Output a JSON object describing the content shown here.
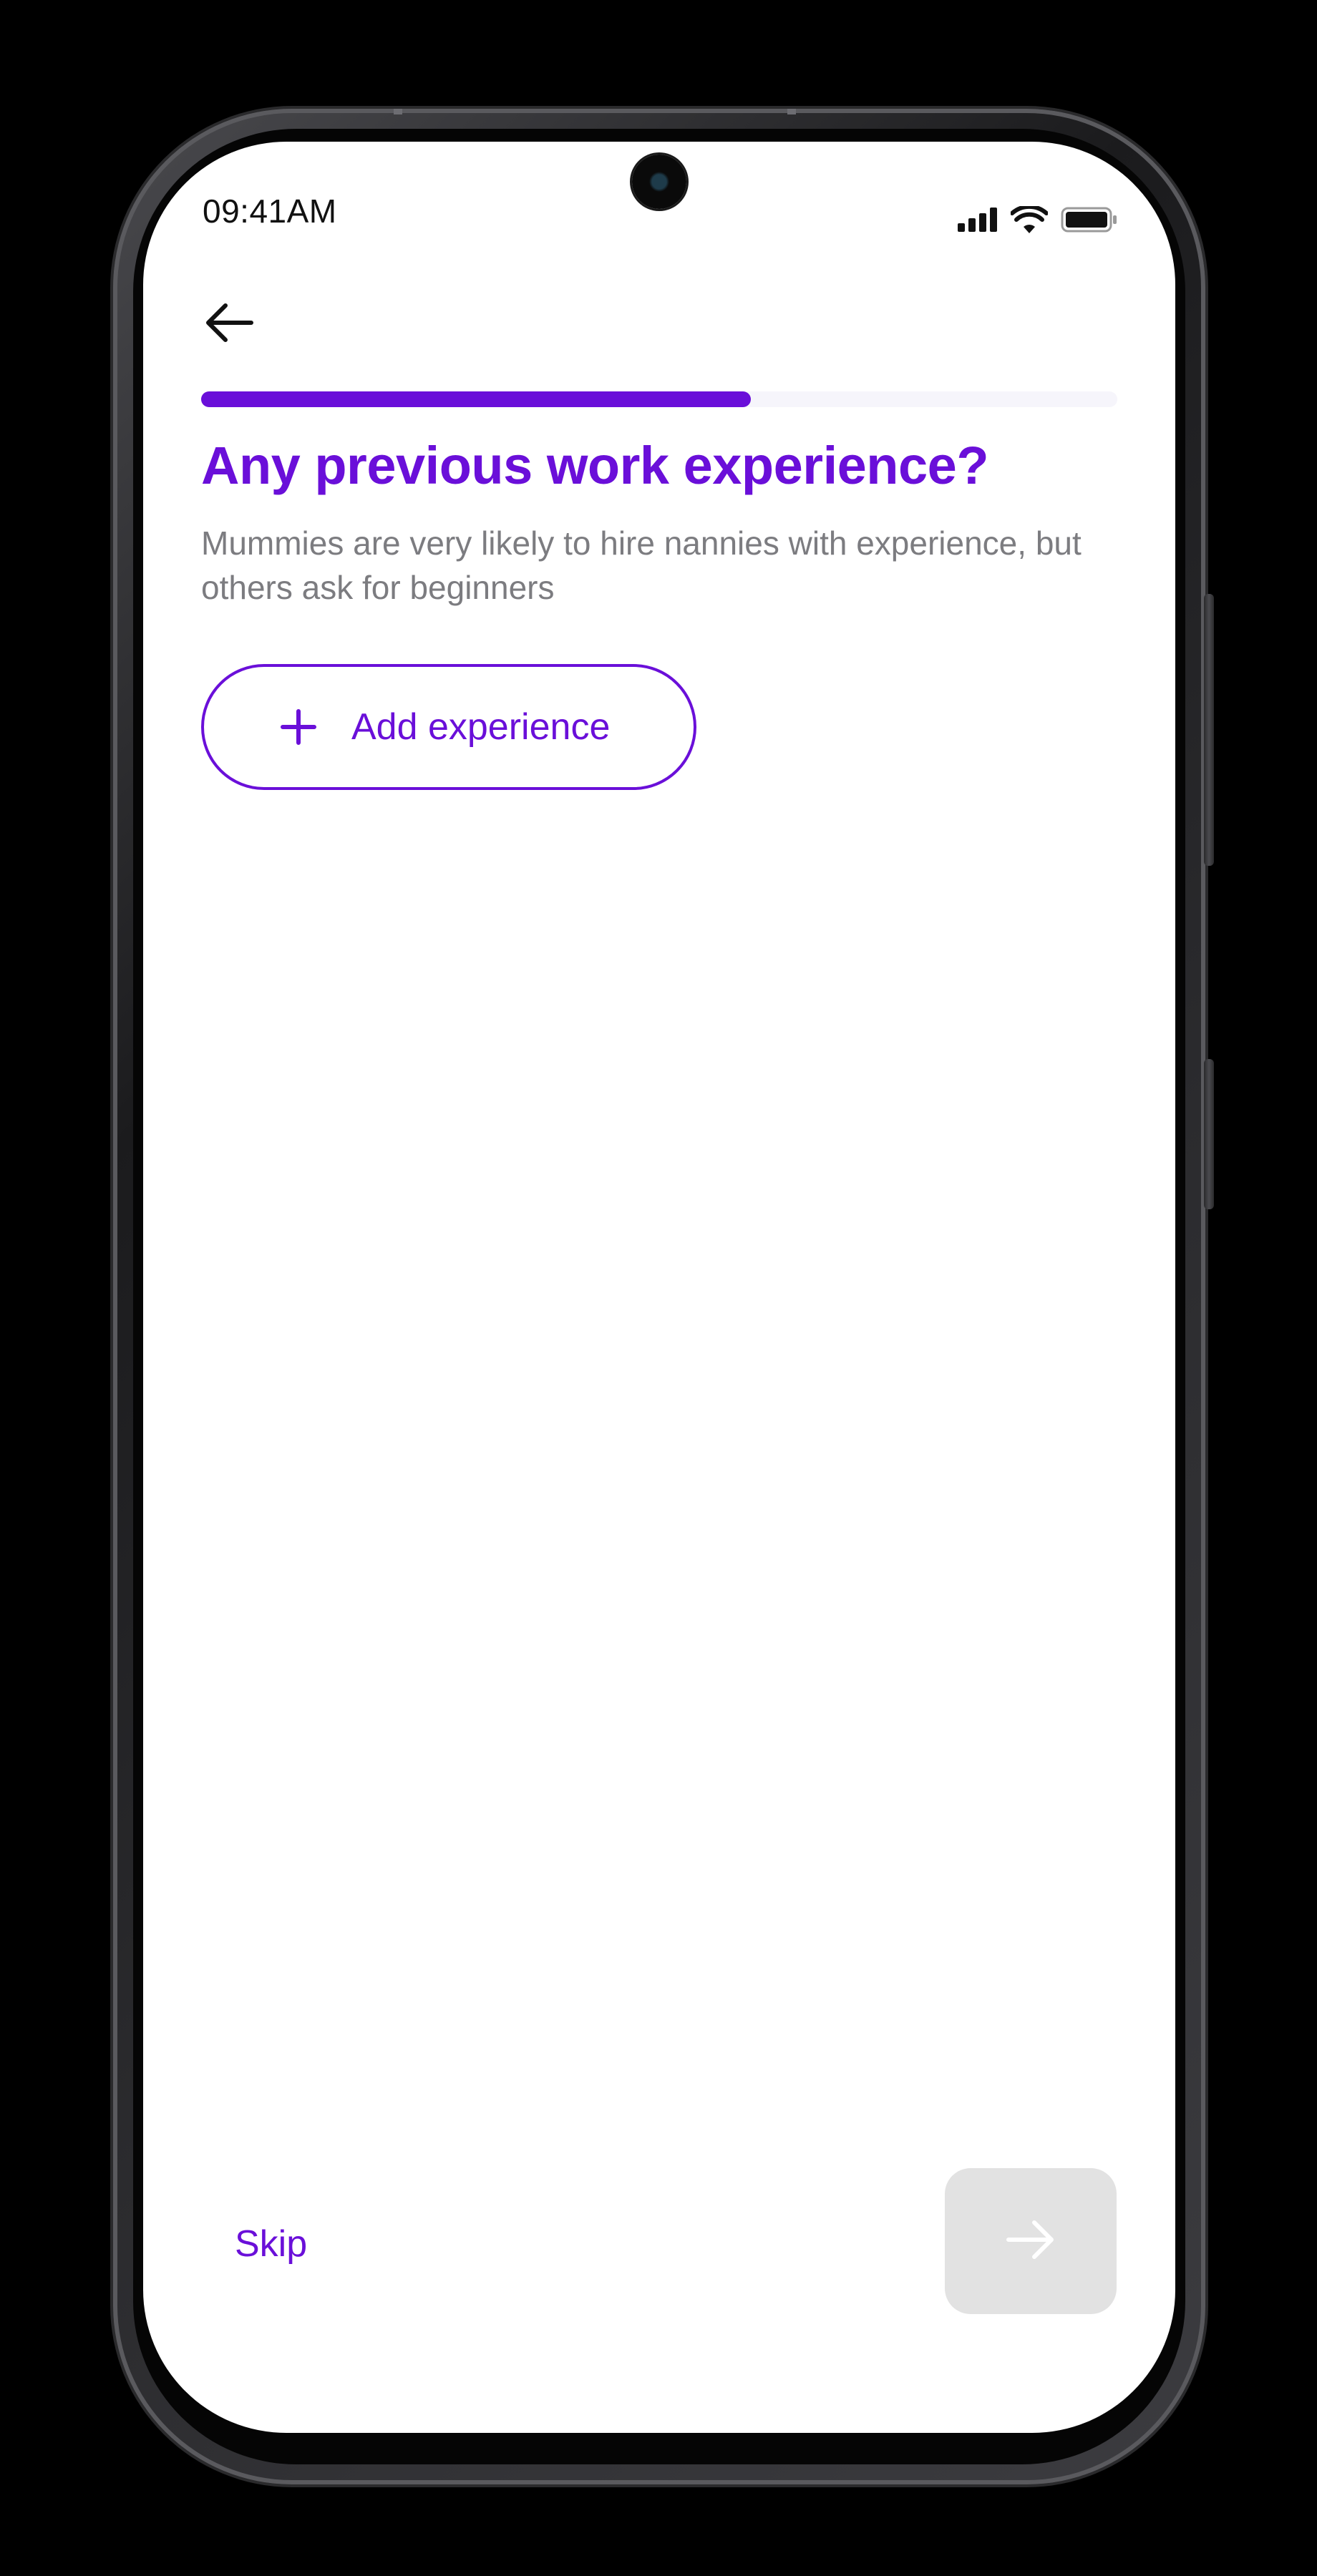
{
  "status_bar": {
    "time": "09:41AM",
    "icons": [
      "signal-icon",
      "wifi-icon",
      "battery-icon"
    ]
  },
  "header": {
    "back_icon": "arrow-left-icon",
    "progress_fraction": 0.6
  },
  "content": {
    "title": "Any previous work experience?",
    "subtitle": "Mummies are very likely to hire nannies with experience, but others ask for beginners",
    "add_button": {
      "icon": "plus-icon",
      "label": "Add experience"
    }
  },
  "footer": {
    "skip_label": "Skip",
    "next_icon": "arrow-right-icon",
    "next_enabled": false
  },
  "colors": {
    "accent": "#6a0fd9",
    "subtitle_text": "#7c7c80",
    "progress_track": "#f6f5fb",
    "next_disabled_bg": "#e2e2e2"
  }
}
